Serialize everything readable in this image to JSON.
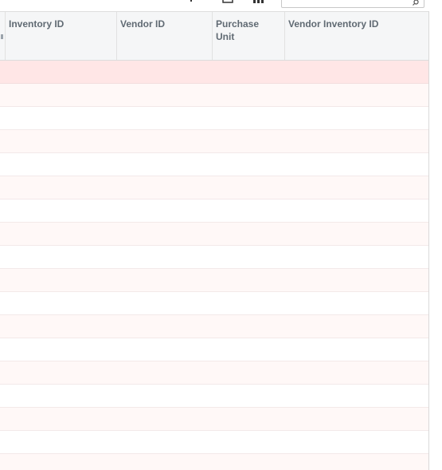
{
  "toolbar": {
    "icons": [
      "filter-icon",
      "export-icon",
      "columns-icon"
    ],
    "search": {
      "placeholder": "",
      "value": ""
    }
  },
  "grid": {
    "columns": [
      {
        "label": "Inventory ID"
      },
      {
        "label": "Vendor ID"
      },
      {
        "label": "Purchase\nUnit"
      },
      {
        "label": "Vendor Inventory ID"
      }
    ],
    "rows": [
      {
        "state": "selected"
      },
      {
        "state": "alt"
      },
      {
        "state": "plain"
      },
      {
        "state": "alt"
      },
      {
        "state": "plain"
      },
      {
        "state": "alt"
      },
      {
        "state": "plain"
      },
      {
        "state": "alt"
      },
      {
        "state": "plain"
      },
      {
        "state": "alt"
      },
      {
        "state": "plain"
      },
      {
        "state": "alt"
      },
      {
        "state": "plain"
      },
      {
        "state": "alt"
      },
      {
        "state": "plain"
      },
      {
        "state": "alt"
      },
      {
        "state": "plain"
      },
      {
        "state": "alt"
      }
    ]
  },
  "colors": {
    "header_bg": "#f5f6f7",
    "header_text": "#606a73",
    "selected_row": "#ffe6e6",
    "alt_row": "#fff8f7"
  }
}
